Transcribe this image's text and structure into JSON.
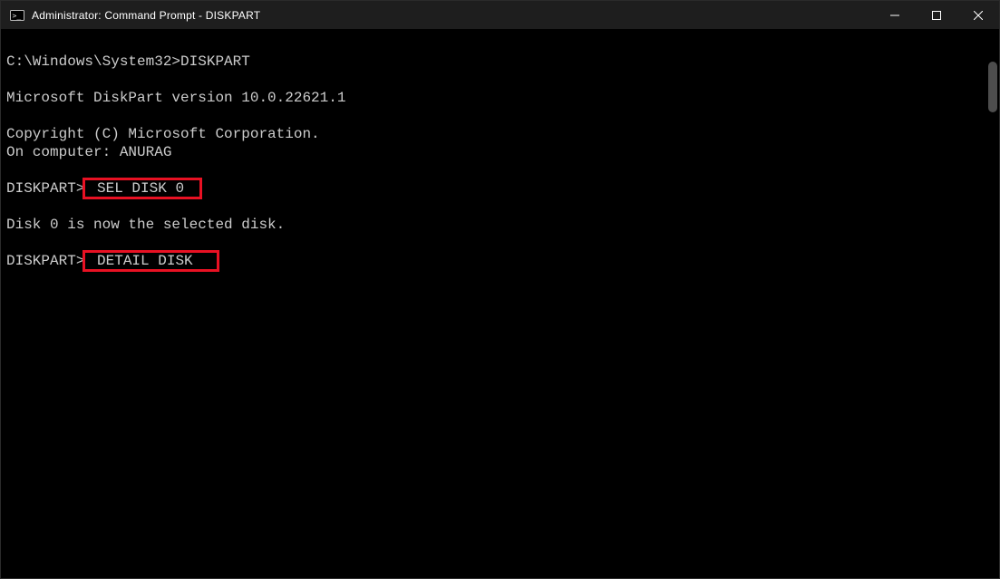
{
  "window": {
    "title": "Administrator: Command Prompt - DISKPART"
  },
  "terminal": {
    "line1_prompt": "C:\\Windows\\System32>",
    "line1_cmd": "DISKPART",
    "blank_a": "",
    "version_line": "Microsoft DiskPart version 10.0.22621.1",
    "blank_b": "",
    "copyright_line": "Copyright (C) Microsoft Corporation.",
    "computer_line": "On computer: ANURAG",
    "blank_c": "",
    "dp_prompt1": "DISKPART>",
    "dp_cmd1": " SEL DISK 0 ",
    "blank_d": "",
    "selected_line": "Disk 0 is now the selected disk.",
    "blank_e": "",
    "dp_prompt2": "DISKPART>",
    "dp_cmd2": " DETAIL DISK"
  },
  "highlights": {
    "box1_target": "SEL DISK 0",
    "box2_target": "DETAIL DISK"
  }
}
